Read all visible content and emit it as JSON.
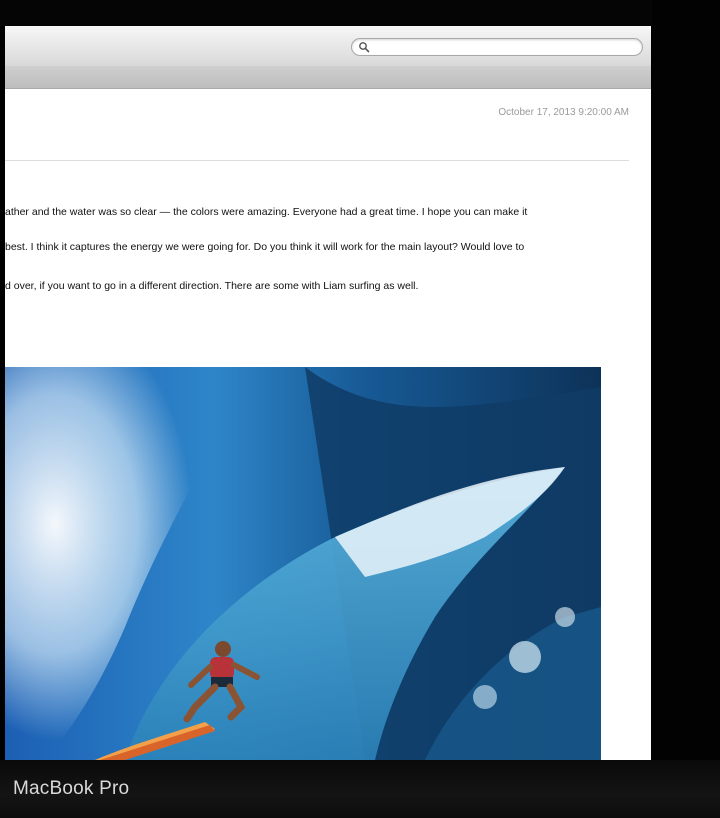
{
  "search": {
    "value": "",
    "placeholder": ""
  },
  "message": {
    "timestamp": "October 17, 2013 9:20:00 AM",
    "lines": [
      "ather and the water was so clear — the colors were amazing. Everyone had a great time. I hope you can make it",
      "best. I think it captures the energy we were going for. Do you think it will work for the main layout? Would love to",
      "d over, if you want to go in a different direction. There are some with Liam surfing as well."
    ]
  },
  "device": {
    "brand": "MacBook Pro"
  }
}
